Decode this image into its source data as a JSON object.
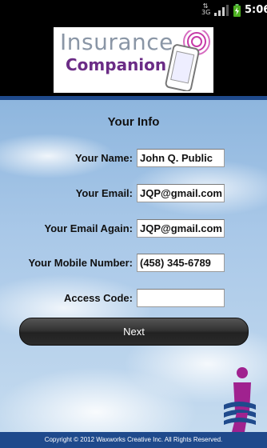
{
  "status_bar": {
    "network_label": "3G",
    "time": "5:06"
  },
  "header": {
    "logo_line1": "Insurance",
    "logo_line2": "Companion"
  },
  "page_title": "Your Info",
  "form": {
    "name_label": "Your Name:",
    "name_value": "John Q. Public",
    "email_label": "Your Email:",
    "email_value": "JQP@gmail.com",
    "email_again_label": "Your Email Again:",
    "email_again_value": "JQP@gmail.com",
    "mobile_label": "Your Mobile Number:",
    "mobile_value": "(458) 345-6789",
    "access_code_label": "Access Code:",
    "access_code_value": ""
  },
  "next_label": "Next",
  "footer_text": "Copyright © 2012 Waxworks Creative Inc. All Rights Reserved.",
  "colors": {
    "brand_blue": "#1f4a8c",
    "logo_purple": "#6b2c86",
    "logo_gray": "#8a96a6"
  }
}
